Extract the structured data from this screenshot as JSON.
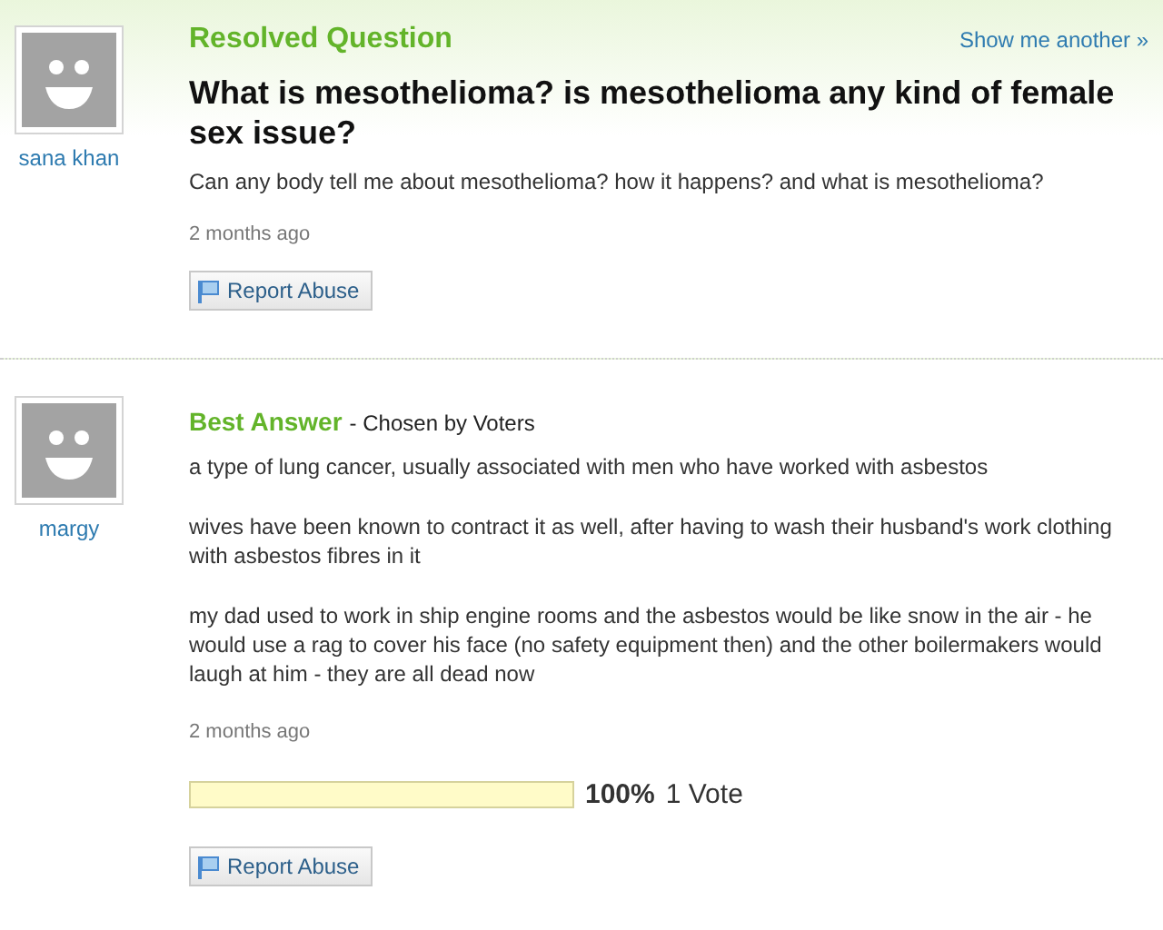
{
  "question": {
    "status": "Resolved Question",
    "show_another": "Show me another »",
    "author": "sana khan",
    "title": "What is mesothelioma? is mesothelioma any kind of female sex issue?",
    "details": "Can any body tell me about mesothelioma? how it happens? and what is mesothelioma?",
    "time": "2 months ago",
    "report_button": "Report Abuse"
  },
  "best_answer": {
    "heading": "Best Answer",
    "chosen_by": "- Chosen by Voters",
    "author": "margy",
    "paragraphs": [
      "a type of lung cancer, usually associated with men who have worked with asbestos",
      "wives have been known to contract it as well, after having to wash their husband's work clothing with asbestos fibres in it",
      "my dad used to work in ship engine rooms and the asbestos would be like snow in the air - he would use a rag to cover his face (no safety equipment then) and the other boilermakers would laugh at him - they are all dead now"
    ],
    "time": "2 months ago",
    "rating": {
      "level": 1,
      "percent": "100%",
      "votes": "1 Vote"
    },
    "report_button": "Report Abuse"
  }
}
